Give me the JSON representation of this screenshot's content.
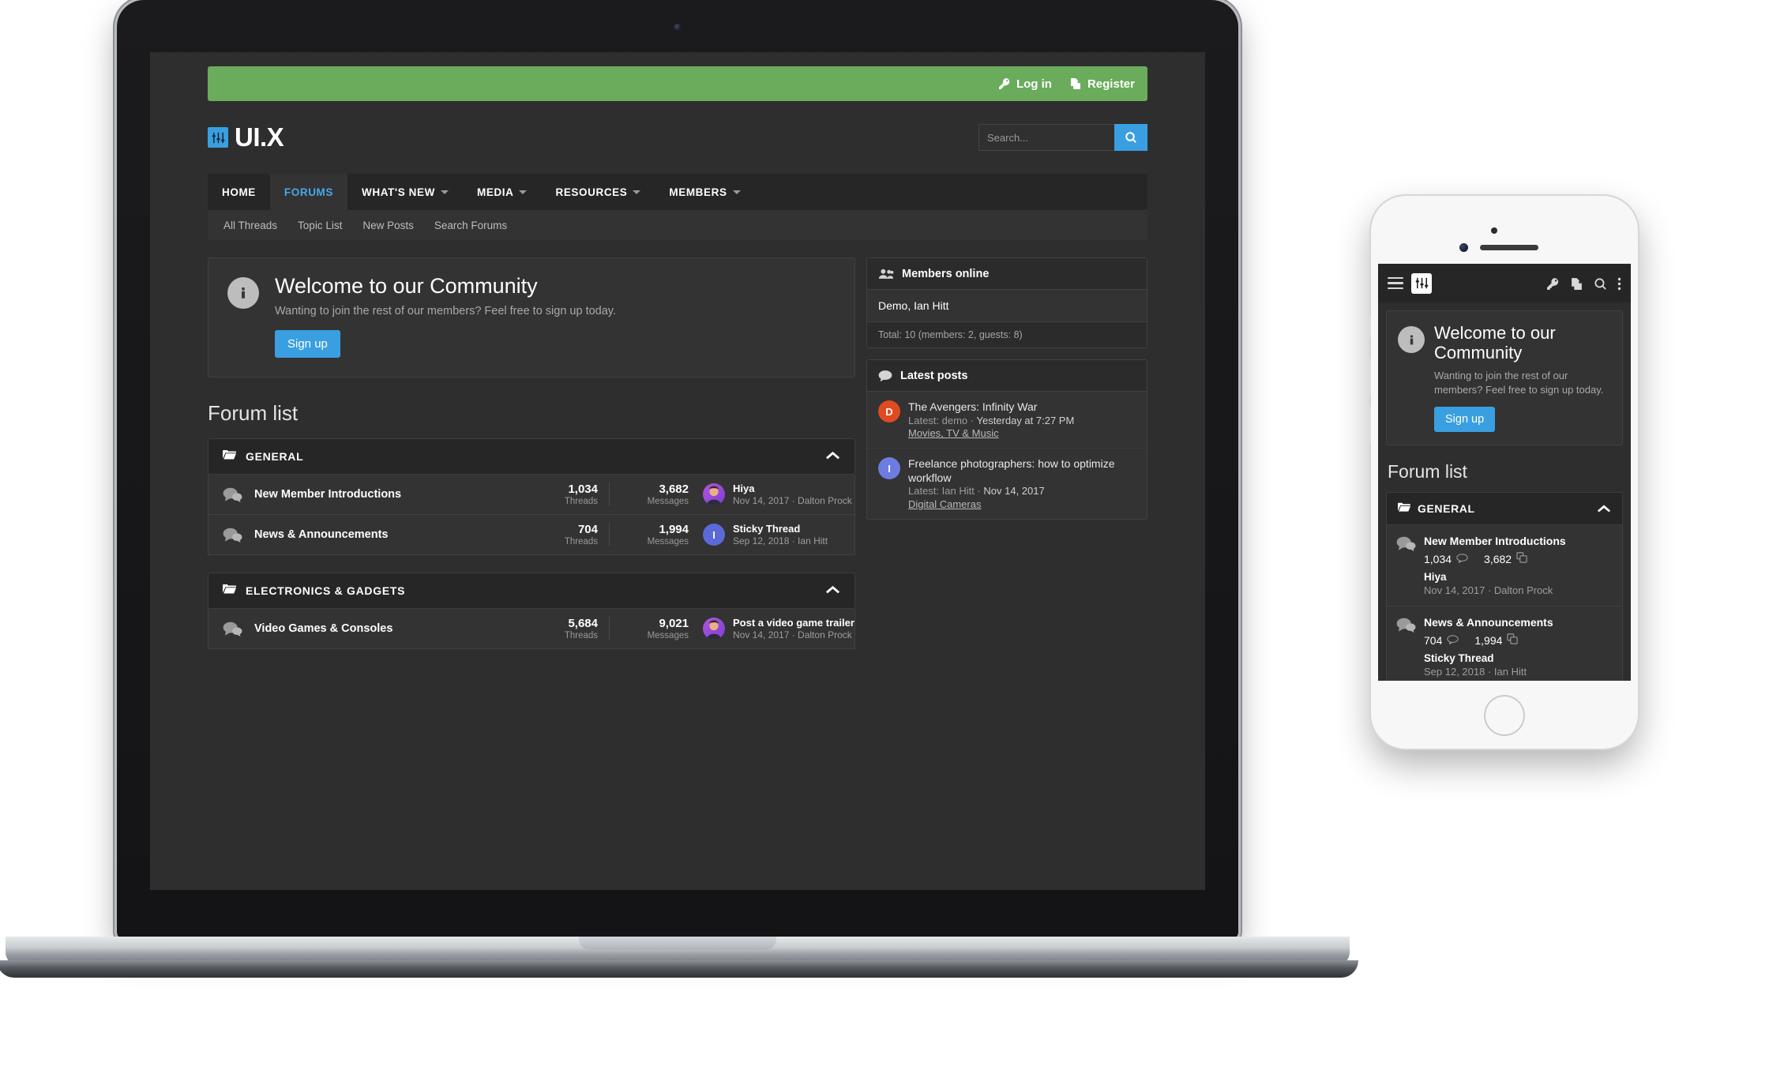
{
  "topbar": {
    "login_label": "Log in",
    "register_label": "Register",
    "login_icon": "key-icon",
    "register_icon": "register-document-icon",
    "background_color": "#6aab5c"
  },
  "brand": {
    "text": "UI.X",
    "logo_icon": "sliders-equalizer-icon",
    "logo_color": "#3a9fe0"
  },
  "search": {
    "placeholder": "Search...",
    "value": "",
    "button_icon": "search-icon",
    "button_color": "#3a9fe0"
  },
  "nav": {
    "items": [
      {
        "label": "HOME",
        "has_caret": false,
        "active": false
      },
      {
        "label": "FORUMS",
        "has_caret": false,
        "active": true
      },
      {
        "label": "WHAT'S NEW",
        "has_caret": true,
        "active": false
      },
      {
        "label": "MEDIA",
        "has_caret": true,
        "active": false
      },
      {
        "label": "RESOURCES",
        "has_caret": true,
        "active": false
      },
      {
        "label": "MEMBERS",
        "has_caret": true,
        "active": false
      }
    ]
  },
  "subnav": {
    "items": [
      "All Threads",
      "Topic List",
      "New Posts",
      "Search Forums"
    ]
  },
  "notice": {
    "icon": "info-icon",
    "title": "Welcome to our Community",
    "body": "Wanting to join the rest of our members? Feel free to sign up today.",
    "button_label": "Sign up",
    "button_color": "#3a9fe0"
  },
  "forum_list": {
    "heading": "Forum list",
    "stat_labels": {
      "threads": "Threads",
      "messages": "Messages"
    },
    "categories": [
      {
        "name": "GENERAL",
        "icon": "folder-icon",
        "collapse_icon": "chevron-up-icon",
        "nodes": [
          {
            "title": "New Member Introductions",
            "icon": "comments-icon",
            "threads": "1,034",
            "messages": "3,682",
            "last_post_title": "Hiya",
            "last_post_meta": "Nov 14, 2017 · Dalton Prock",
            "avatar_type": "photo",
            "avatar_color": "#b255e0",
            "avatar_initial": ""
          },
          {
            "title": "News & Announcements",
            "icon": "comments-icon",
            "threads": "704",
            "messages": "1,994",
            "last_post_title": "Sticky Thread",
            "last_post_meta": "Sep 12, 2018 · Ian Hitt",
            "avatar_type": "initial",
            "avatar_color": "#5b6ad8",
            "avatar_initial": "I"
          }
        ]
      },
      {
        "name": "ELECTRONICS & GADGETS",
        "icon": "folder-icon",
        "collapse_icon": "chevron-up-icon",
        "nodes": [
          {
            "title": "Video Games & Consoles",
            "icon": "comments-icon",
            "threads": "5,684",
            "messages": "9,021",
            "last_post_title": "Post a video game trailer",
            "last_post_meta": "Nov 14, 2017 · Dalton Prock",
            "avatar_type": "photo",
            "avatar_color": "#b255e0",
            "avatar_initial": ""
          }
        ]
      }
    ]
  },
  "sidebar": {
    "members_online": {
      "title": "Members online",
      "icon": "users-icon",
      "names": "Demo, Ian Hitt",
      "total": "Total: 10 (members: 2, guests: 8)"
    },
    "latest_posts": {
      "title": "Latest posts",
      "icon": "comment-icon",
      "items": [
        {
          "title": "The Avengers: Infinity War",
          "meta_prefix": "Latest: demo · ",
          "meta_time": "Yesterday at 7:27 PM",
          "forum": "Movies, TV & Music",
          "avatar_color": "#e04a20",
          "avatar_initial": "D"
        },
        {
          "title": "Freelance photographers: how to optimize workflow",
          "meta_prefix": "Latest: Ian Hitt · ",
          "meta_time": "Nov 14, 2017",
          "forum": "Digital Cameras",
          "avatar_color": "#6d7ce0",
          "avatar_initial": "I"
        }
      ]
    }
  },
  "mobile": {
    "bar": {
      "menu_icon": "hamburger-icon",
      "logo_icon": "sliders-equalizer-icon",
      "login_icon": "key-icon",
      "register_icon": "register-document-icon",
      "search_icon": "search-icon",
      "more_icon": "vertical-dots-icon"
    },
    "notice": {
      "icon": "info-icon",
      "title": "Welcome to our Community",
      "body": "Wanting to join the rest of our members? Feel free to sign up today.",
      "button_label": "Sign up"
    },
    "forum_list": {
      "heading": "Forum list",
      "categories": [
        {
          "name": "GENERAL",
          "icon": "folder-icon",
          "collapse_icon": "chevron-up-icon",
          "nodes": [
            {
              "title": "New Member Introductions",
              "icon": "comments-icon",
              "threads": "1,034",
              "messages": "3,682",
              "last_post_title": "Hiya",
              "last_post_meta": "Nov 14, 2017 · Dalton Prock"
            },
            {
              "title": "News & Announcements",
              "icon": "comments-icon",
              "threads": "704",
              "messages": "1,994",
              "last_post_title": "Sticky Thread",
              "last_post_meta": "Sep 12, 2018 · Ian Hitt"
            }
          ]
        }
      ]
    }
  }
}
